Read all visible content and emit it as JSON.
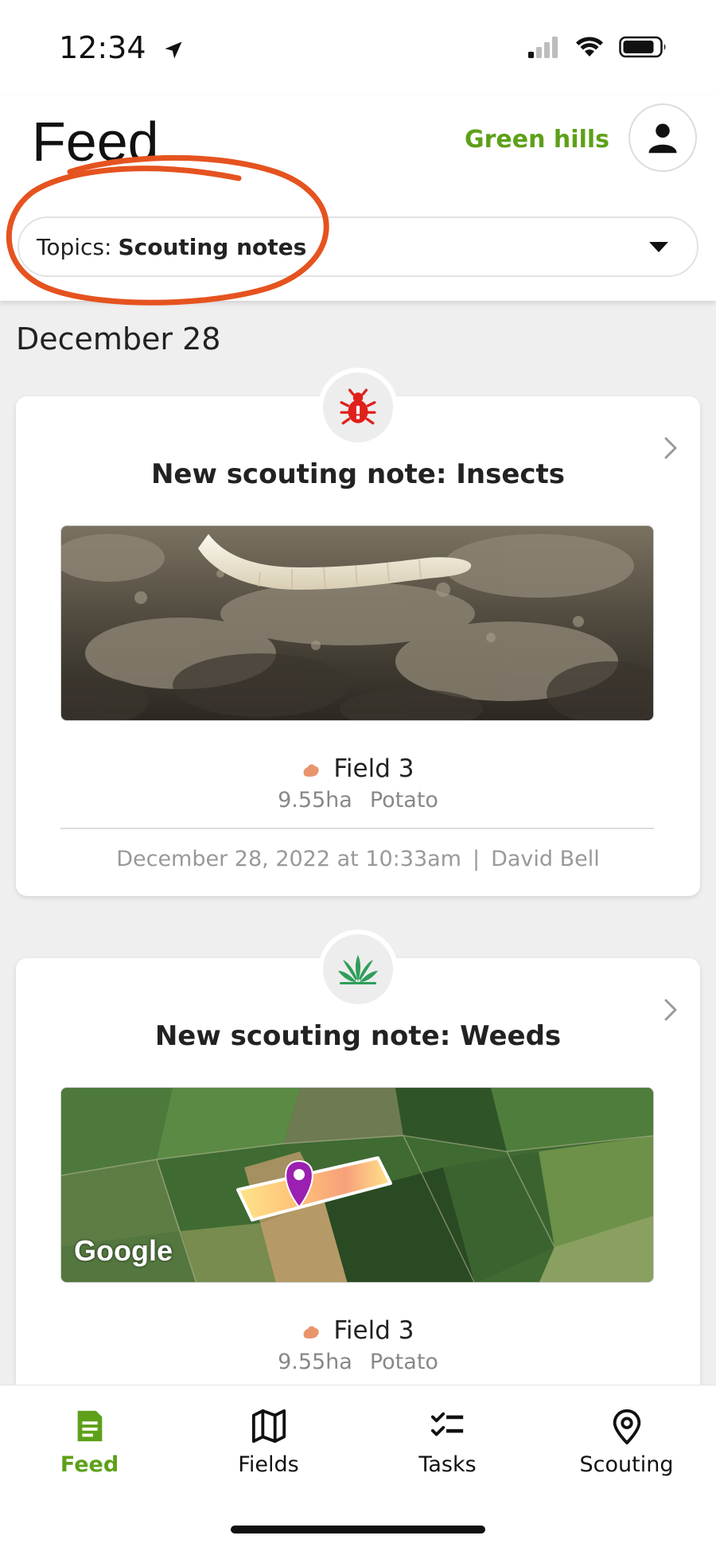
{
  "status_bar": {
    "time": "12:34"
  },
  "header": {
    "title": "Feed",
    "farm_name": "Green hills",
    "topics_prefix": "Topics:",
    "topics_value": "Scouting notes"
  },
  "feed": {
    "date_heading": "December 28",
    "cards": [
      {
        "badge_icon": "bug-icon",
        "title": "New scouting note: Insects",
        "field_name": "Field 3",
        "area": "9.55ha",
        "crop": "Potato",
        "timestamp": "December 28, 2022 at 10:33am",
        "separator": "|",
        "author": "David Bell"
      },
      {
        "badge_icon": "weed-icon",
        "title": "New scouting note: Weeds",
        "map_attribution": "Google",
        "field_name": "Field 3",
        "area": "9.55ha",
        "crop": "Potato"
      }
    ]
  },
  "tabs": [
    {
      "label": "Feed",
      "icon": "document-icon",
      "active": true
    },
    {
      "label": "Fields",
      "icon": "map-icon",
      "active": false
    },
    {
      "label": "Tasks",
      "icon": "checklist-icon",
      "active": false
    },
    {
      "label": "Scouting",
      "icon": "location-pin-icon",
      "active": false
    }
  ],
  "colors": {
    "accent": "#5ea019",
    "annotation": "#e5531f",
    "insect_icon": "#e0201b",
    "weed_icon": "#2f9e5a",
    "pin": "#9b1fb0"
  }
}
